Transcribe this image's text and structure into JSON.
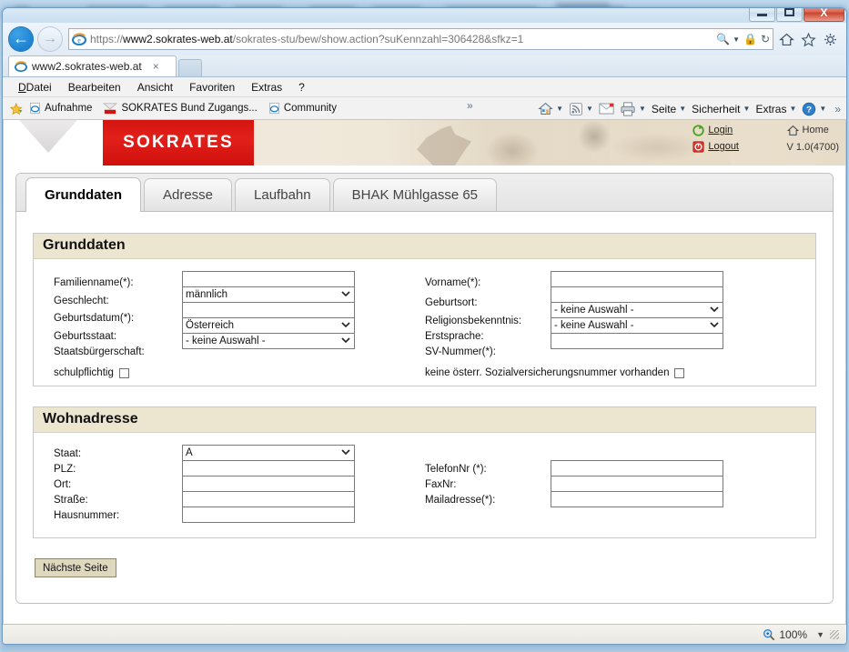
{
  "window": {
    "minimize_label": "Minimize",
    "maximize_label": "Maximize",
    "close_label": "X"
  },
  "browser": {
    "back_label": "←",
    "forward_label": "→",
    "url_protocol": "https://",
    "url_host": "www2.sokrates-web.at",
    "url_path": "/sokrates-stu/bew/show.action?suKennzahl=306428&sfkz=1",
    "search_icon": "search-icon",
    "lock_icon": "lock-icon",
    "refresh_icon": "refresh-icon",
    "home_icon": "home-icon",
    "favorites_icon": "star-icon",
    "tools_icon": "gear-icon",
    "tab_title": "www2.sokrates-web.at",
    "tab_close": "×",
    "new_tab_label": "",
    "menu": [
      {
        "label": "Datei",
        "accel": "D"
      },
      {
        "label": "Bearbeiten",
        "accel": "B"
      },
      {
        "label": "Ansicht",
        "accel": "A"
      },
      {
        "label": "Favoriten",
        "accel": "F"
      },
      {
        "label": "Extras",
        "accel": "x"
      },
      {
        "label": "?",
        "accel": ""
      }
    ],
    "favorites": [
      {
        "label": "Aufnahme",
        "icon": "ie-page-icon"
      },
      {
        "label": "SOKRATES Bund Zugangs...",
        "icon": "sokrates-icon"
      },
      {
        "label": "Community",
        "icon": "ie-page-icon"
      }
    ],
    "favorites_overflow": "»",
    "command_bar": [
      {
        "label": "Seite",
        "icon": "page-icon"
      },
      {
        "label": "Sicherheit",
        "icon": "shield-icon"
      },
      {
        "label": "Extras",
        "icon": "tools-icon"
      }
    ],
    "command_overflow": "»",
    "zoom_level": "100%",
    "zoom_caret": "▼"
  },
  "banner": {
    "logo_text": "SOKRATES",
    "login_label": "Login",
    "logout_label": "Logout",
    "home_label": "Home",
    "version": "V 1.0(4700)"
  },
  "app_tabs": [
    {
      "label": "Grunddaten",
      "active": true
    },
    {
      "label": "Adresse",
      "active": false
    },
    {
      "label": "Laufbahn",
      "active": false
    },
    {
      "label": "BHAK Mühlgasse 65",
      "active": false
    }
  ],
  "grunddaten": {
    "section_title": "Grunddaten",
    "left_fields": [
      {
        "label": "Familienname(*):",
        "type": "text",
        "value": ""
      },
      {
        "label": "Geschlecht:",
        "type": "select",
        "value": "männlich"
      },
      {
        "label": "Geburtsdatum(*):",
        "type": "text",
        "value": ""
      },
      {
        "label": "Geburtsstaat:",
        "type": "select",
        "value": "Österreich"
      },
      {
        "label": "Staatsbürgerschaft:",
        "type": "select",
        "value": "- keine Auswahl -"
      }
    ],
    "left_checkbox": {
      "label": "schulpflichtig",
      "checked": false
    },
    "right_fields": [
      {
        "label": "Vorname(*):",
        "type": "text",
        "value": ""
      },
      {
        "label": "Geburtsort:",
        "type": "text",
        "value": ""
      },
      {
        "label": "Religionsbekenntnis:",
        "type": "select",
        "value": "- keine Auswahl -"
      },
      {
        "label": "Erstsprache:",
        "type": "select",
        "value": "- keine Auswahl -"
      },
      {
        "label": "SV-Nummer(*):",
        "type": "text",
        "value": ""
      }
    ],
    "right_checkbox": {
      "label": "keine österr. Sozialversicherungsnummer vorhanden",
      "checked": false
    }
  },
  "wohnadresse": {
    "section_title": "Wohnadresse",
    "left_fields": [
      {
        "label": "Staat:",
        "type": "select",
        "value": "A"
      },
      {
        "label": "PLZ:",
        "type": "text",
        "value": ""
      },
      {
        "label": "Ort:",
        "type": "text",
        "value": ""
      },
      {
        "label": "Straße:",
        "type": "text",
        "value": ""
      },
      {
        "label": "Hausnummer:",
        "type": "text",
        "value": ""
      }
    ],
    "right_fields": [
      {
        "label": "TelefonNr (*):",
        "type": "text",
        "value": ""
      },
      {
        "label": "FaxNr:",
        "type": "text",
        "value": ""
      },
      {
        "label": "Mailadresse(*):",
        "type": "text",
        "value": ""
      }
    ]
  },
  "actions": {
    "next_button": "Nächste Seite"
  },
  "colors": {
    "brand_red": "#d4140f",
    "section_header": "#ece5cf",
    "button_face": "#ded8bf",
    "accent_blue": "#0f72c4"
  }
}
